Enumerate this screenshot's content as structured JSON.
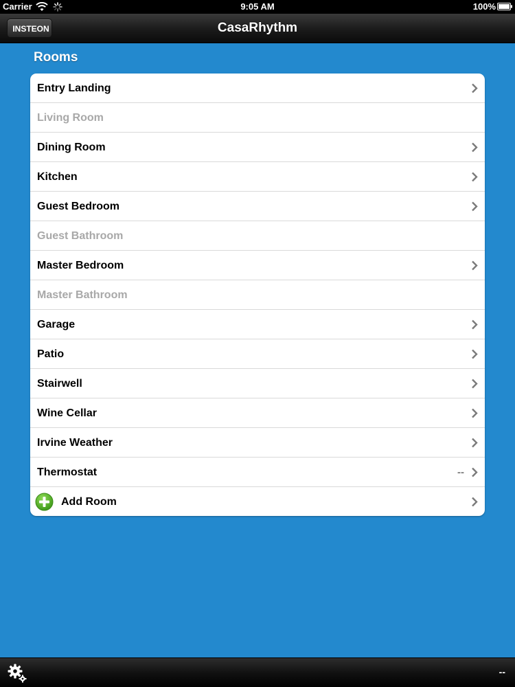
{
  "status_bar": {
    "carrier": "Carrier",
    "time": "9:05 AM",
    "battery": "100%"
  },
  "nav_bar": {
    "back_label": "INSTEON",
    "title": "CasaRhythm"
  },
  "section": {
    "title": "Rooms"
  },
  "rooms": [
    {
      "label": "Entry Landing",
      "enabled": true
    },
    {
      "label": "Living Room",
      "enabled": false
    },
    {
      "label": "Dining Room",
      "enabled": true
    },
    {
      "label": "Kitchen",
      "enabled": true
    },
    {
      "label": "Guest Bedroom",
      "enabled": true
    },
    {
      "label": "Guest Bathroom",
      "enabled": false
    },
    {
      "label": "Master Bedroom",
      "enabled": true
    },
    {
      "label": "Master Bathroom",
      "enabled": false
    },
    {
      "label": "Garage",
      "enabled": true
    },
    {
      "label": "Patio",
      "enabled": true
    },
    {
      "label": "Stairwell",
      "enabled": true
    },
    {
      "label": "Wine Cellar",
      "enabled": true
    },
    {
      "label": "Irvine Weather",
      "enabled": true
    },
    {
      "label": "Thermostat",
      "enabled": true,
      "detail": "--"
    }
  ],
  "add_room": {
    "label": "Add Room"
  },
  "toolbar": {
    "status": "--"
  },
  "colors": {
    "background": "#2389ce",
    "disabled_text": "#a8a8a8",
    "add_icon": "#5cb82a"
  }
}
